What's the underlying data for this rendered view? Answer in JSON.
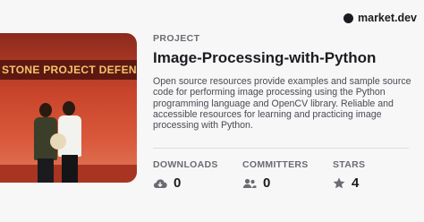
{
  "brand": {
    "name": "market.dev",
    "icon": "circle-logo-icon"
  },
  "photo": {
    "banner_text": "STONE PROJECT DEFEN"
  },
  "project": {
    "kicker": "PROJECT",
    "title": "Image-Processing-with-Python",
    "description": "Open source resources provide examples and sample source code for performing image processing using the Python programming language and OpenCV library. Reliable and accessible resources for learning and practicing image processing with Python."
  },
  "stats": [
    {
      "label": "DOWNLOADS",
      "value": "0",
      "icon": "cloud-download-icon"
    },
    {
      "label": "COMMITTERS",
      "value": "0",
      "icon": "people-icon"
    },
    {
      "label": "STARS",
      "value": "4",
      "icon": "star-icon"
    }
  ],
  "colors": {
    "text": "#1c1c20",
    "muted": "#6b6b72",
    "background": "#f7f7f8"
  }
}
